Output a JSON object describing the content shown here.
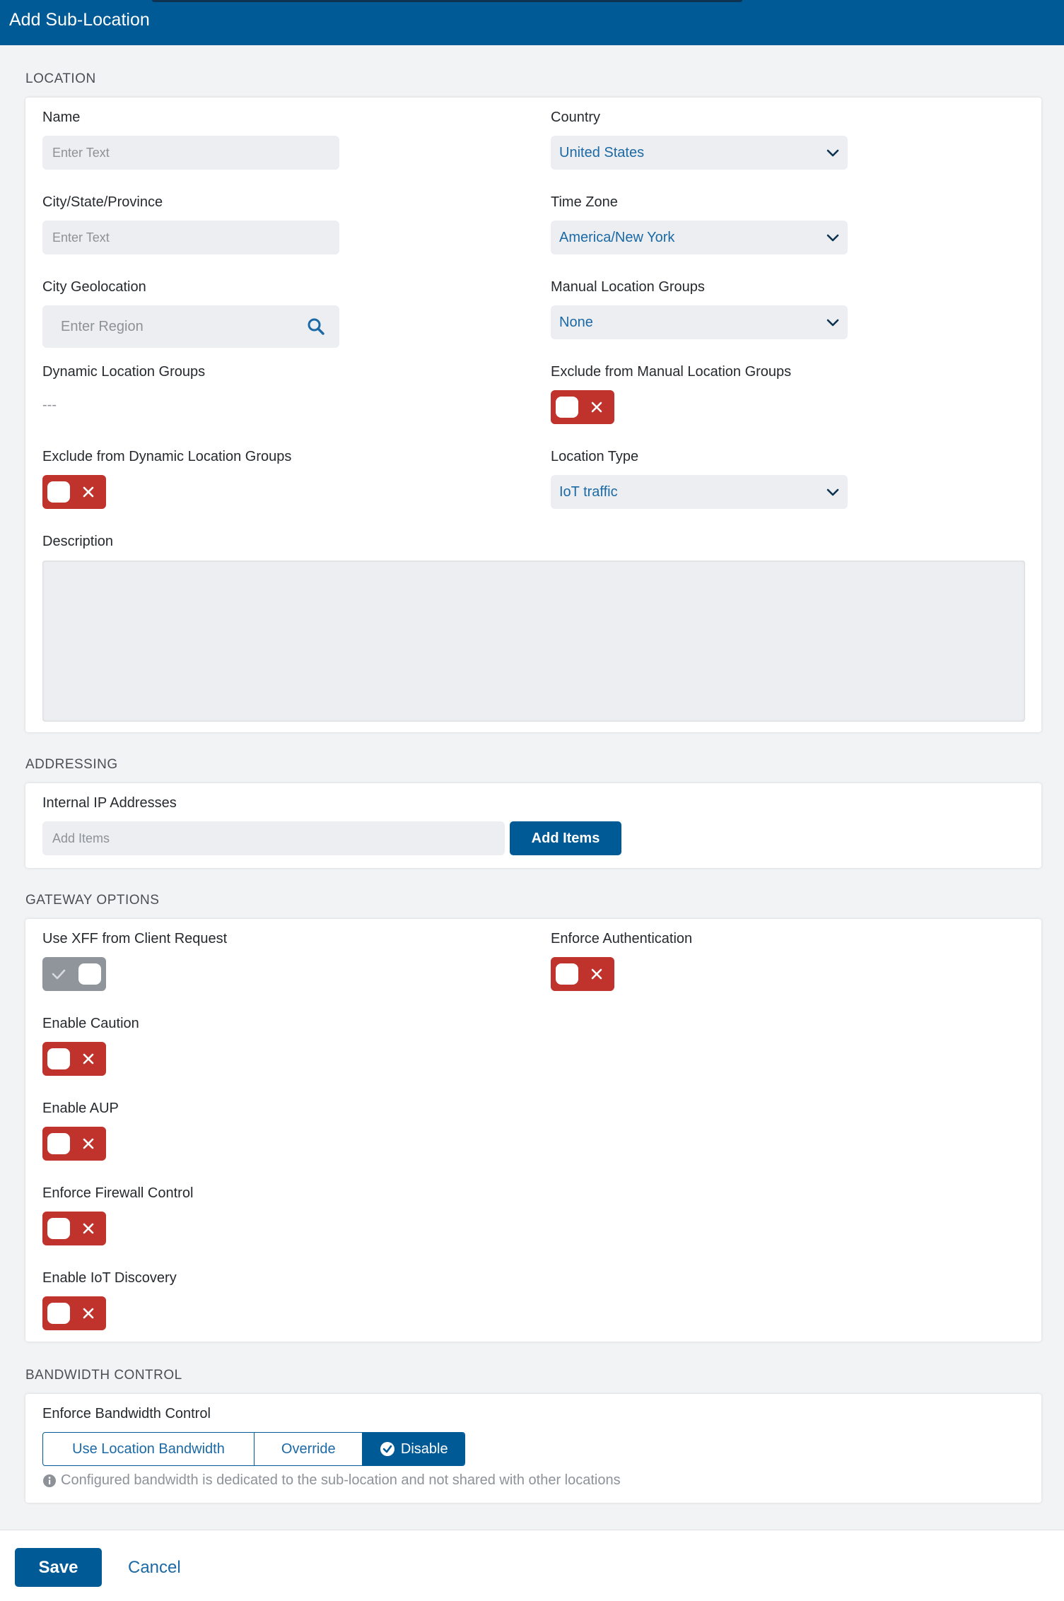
{
  "header": {
    "title": "Add Sub-Location"
  },
  "sections": {
    "location": "LOCATION",
    "addressing": "ADDRESSING",
    "gateway": "GATEWAY OPTIONS",
    "bandwidth": "BANDWIDTH CONTROL"
  },
  "location": {
    "name_label": "Name",
    "name_placeholder": "Enter Text",
    "country_label": "Country",
    "country_value": "United States",
    "city_label": "City/State/Province",
    "city_placeholder": "Enter Text",
    "timezone_label": "Time Zone",
    "timezone_value": "America/New York",
    "geolocation_label": "City Geolocation",
    "geolocation_placeholder": "Enter Region",
    "manual_groups_label": "Manual Location Groups",
    "manual_groups_value": "None",
    "dynamic_groups_label": "Dynamic Location Groups",
    "dynamic_groups_value": "---",
    "exclude_manual_label": "Exclude from Manual Location Groups",
    "exclude_manual_enabled": false,
    "exclude_dynamic_label": "Exclude from Dynamic Location Groups",
    "exclude_dynamic_enabled": false,
    "location_type_label": "Location Type",
    "location_type_value": "IoT traffic",
    "description_label": "Description"
  },
  "addressing": {
    "internal_ip_label": "Internal IP Addresses",
    "internal_ip_placeholder": "Add Items",
    "add_items_button": "Add Items"
  },
  "gateway": {
    "xff_label": "Use XFF from Client Request",
    "xff_enabled": true,
    "enforce_auth_label": "Enforce Authentication",
    "enforce_auth_enabled": false,
    "caution_label": "Enable Caution",
    "caution_enabled": false,
    "aup_label": "Enable AUP",
    "aup_enabled": false,
    "firewall_label": "Enforce Firewall Control",
    "firewall_enabled": false,
    "iot_label": "Enable IoT Discovery",
    "iot_enabled": false
  },
  "bandwidth": {
    "enforce_label": "Enforce Bandwidth Control",
    "options": [
      "Use Location Bandwidth",
      "Override",
      "Disable"
    ],
    "selected": "Disable",
    "info": "Configured bandwidth is dedicated to the sub-location and not shared with other locations"
  },
  "footer": {
    "save": "Save",
    "cancel": "Cancel"
  },
  "colors": {
    "brand": "#005a96",
    "toggle_off": "#c0322c",
    "toggle_on": "#8f959b",
    "link": "#1b69a5"
  }
}
